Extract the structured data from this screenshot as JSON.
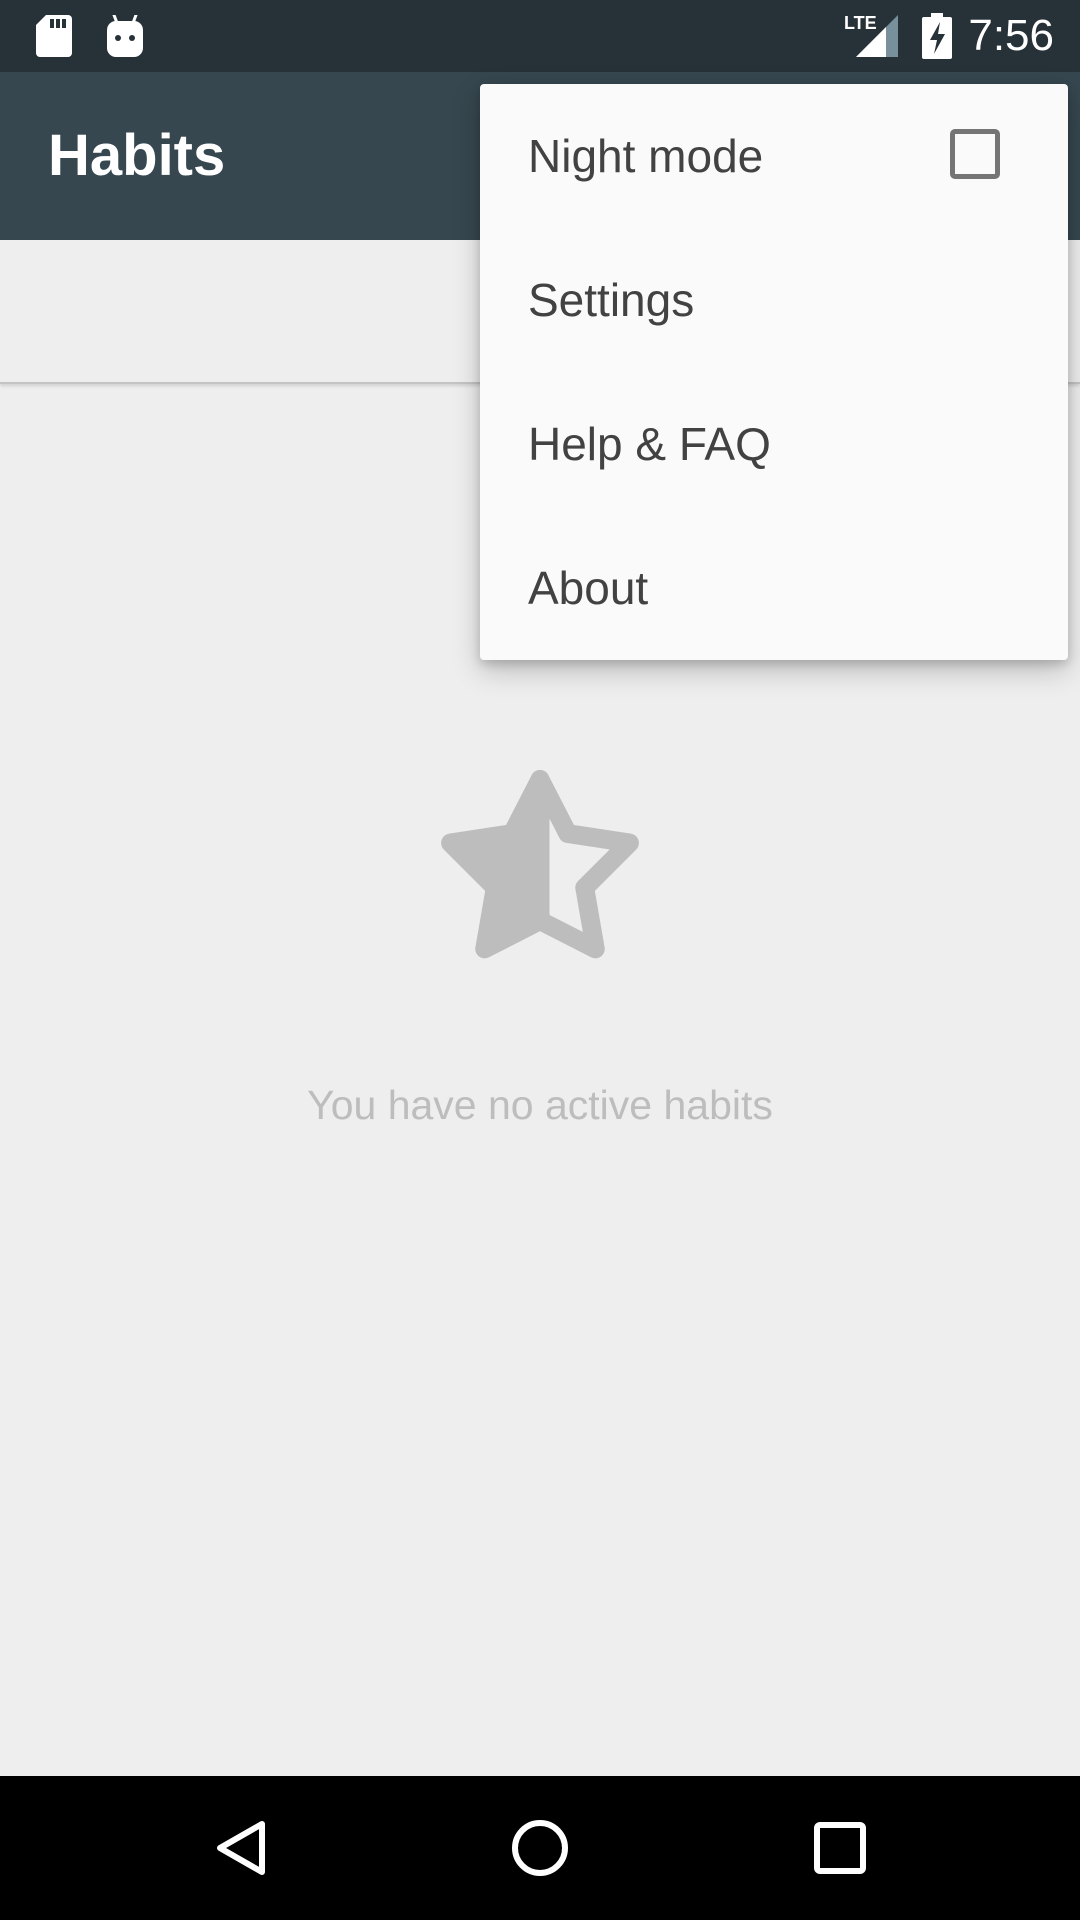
{
  "status_bar": {
    "time": "7:56",
    "network_label": "LTE",
    "icons": [
      "sd-card-icon",
      "android-icon",
      "lte-signal-icon",
      "battery-charging-icon"
    ]
  },
  "app_bar": {
    "title": "Habits",
    "background_color": "#37474f"
  },
  "overflow_menu": {
    "items": [
      {
        "label": "Night mode",
        "checkbox": true,
        "checked": false
      },
      {
        "label": "Settings"
      },
      {
        "label": "Help & FAQ"
      },
      {
        "label": "About"
      }
    ]
  },
  "empty_state": {
    "icon": "star-half-icon",
    "message": "You have no active habits"
  },
  "nav_bar": {
    "buttons": [
      "back-icon",
      "home-icon",
      "recents-icon"
    ]
  },
  "colors": {
    "status_bar": "#263238",
    "app_bar": "#37474f",
    "background": "#eeeeee",
    "menu_background": "#fafafa",
    "empty_text": "#bdbdbd"
  }
}
